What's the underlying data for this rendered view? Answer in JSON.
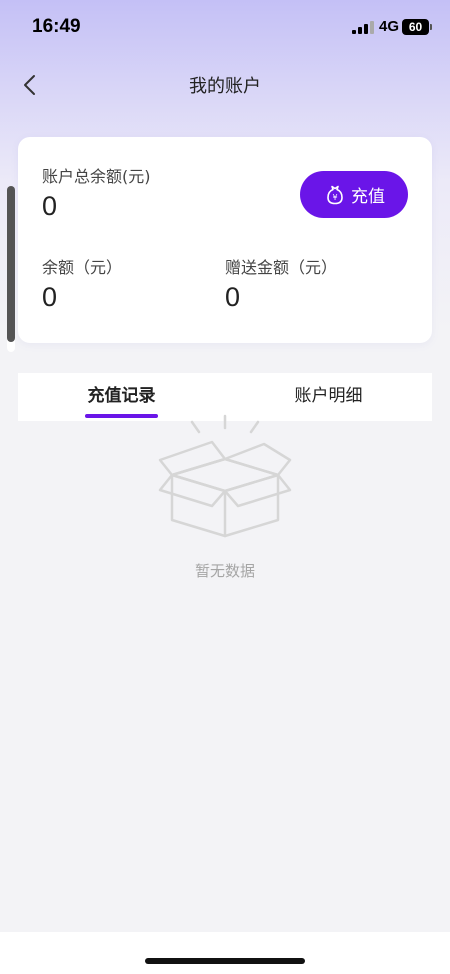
{
  "status_bar": {
    "time": "16:49",
    "network": "4G",
    "battery": "60"
  },
  "nav": {
    "title": "我的账户",
    "back_icon": "chevron-left-icon"
  },
  "account_card": {
    "total_label": "账户总余额(元)",
    "total_value": "0",
    "recharge_label": "充值",
    "recharge_icon": "money-bag-icon",
    "balance_label": "余额（元）",
    "balance_value": "0",
    "bonus_label": "赠送金额（元）",
    "bonus_value": "0"
  },
  "tabs": [
    {
      "label": "充值记录",
      "active": true
    },
    {
      "label": "账户明细",
      "active": false
    }
  ],
  "empty_state": {
    "icon": "empty-box-icon",
    "text": "暂无数据"
  },
  "colors": {
    "accent": "#6a15e8",
    "background": "#f3f3f6",
    "header_gradient_top": "#c4c0f6"
  }
}
